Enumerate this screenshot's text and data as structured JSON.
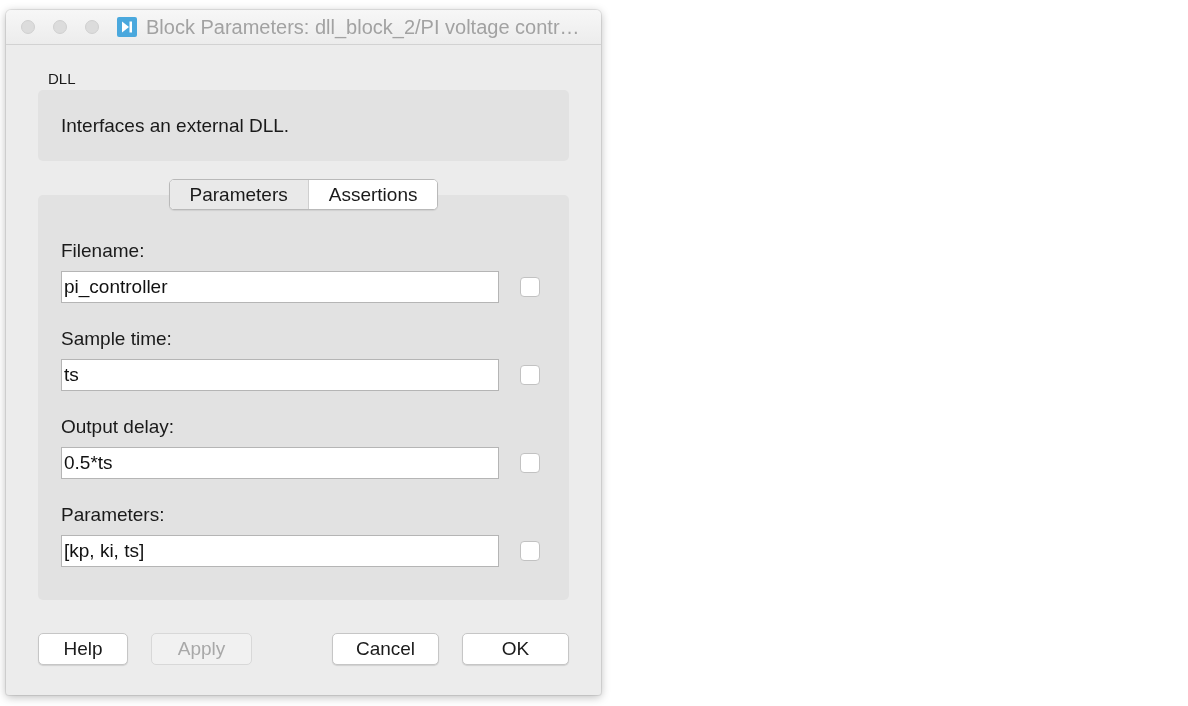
{
  "window": {
    "title": "Block Parameters: dll_block_2/PI voltage contr…"
  },
  "block": {
    "type": "DLL",
    "description": "Interfaces an external DLL."
  },
  "tabs": [
    {
      "label": "Parameters",
      "selected": true
    },
    {
      "label": "Assertions",
      "selected": false
    }
  ],
  "fields": [
    {
      "label": "Filename:",
      "value": "pi_controller",
      "checked": false
    },
    {
      "label": "Sample time:",
      "value": "ts",
      "checked": false
    },
    {
      "label": "Output delay:",
      "value": "0.5*ts",
      "checked": false
    },
    {
      "label": "Parameters:",
      "value": "[kp, ki, ts]",
      "checked": false
    }
  ],
  "buttons": {
    "left": [
      {
        "label": "Help",
        "disabled": false
      },
      {
        "label": "Apply",
        "disabled": true
      }
    ],
    "right": [
      {
        "label": "Cancel",
        "disabled": false
      },
      {
        "label": "OK",
        "disabled": false
      }
    ]
  }
}
